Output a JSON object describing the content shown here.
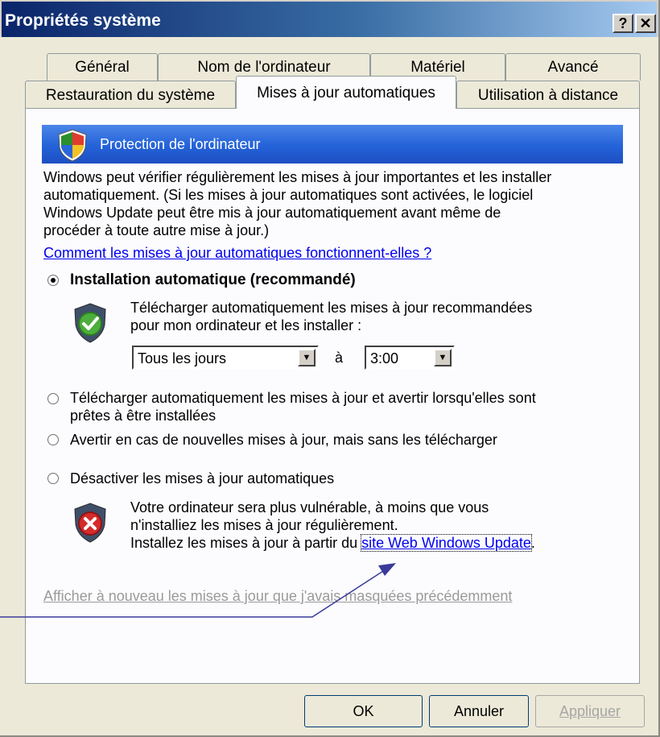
{
  "window": {
    "title": "Propriétés système",
    "help_label": "?",
    "close_label": "✕"
  },
  "tabs": {
    "row1": [
      "Général",
      "Nom de l'ordinateur",
      "Matériel",
      "Avancé"
    ],
    "row2": [
      "Restauration du système",
      "Mises à jour automatiques",
      "Utilisation à distance"
    ]
  },
  "banner": {
    "title": "Protection de l'ordinateur",
    "icon": "windows-security-shield-icon"
  },
  "intro": {
    "lines": [
      "Windows peut vérifier régulièrement les mises à jour importantes et les installer",
      "automatiquement. (Si les mises à jour automatiques sont activées, le logiciel",
      "Windows Update peut être mis à jour automatiquement avant même de",
      "procéder à toute autre mise à jour.)"
    ],
    "link": "Comment les mises à jour automatiques fonctionnent-elles ?"
  },
  "options": {
    "auto_install": {
      "label": "Installation automatique (recommandé)",
      "selected": true,
      "desc_line1": "Télécharger automatiquement les mises à jour recommandées",
      "desc_line2": "pour mon ordinateur et les installer :",
      "frequency": "Tous les jours",
      "at_label": "à",
      "time": "3:00",
      "icon": "green-check-shield-icon"
    },
    "download_notify": {
      "line1": "Télécharger automatiquement les mises à jour et avertir lorsqu'elles sont",
      "line2": "prêtes à être installées",
      "selected": false
    },
    "notify_only": {
      "label": "Avertir en cas de nouvelles mises à jour, mais sans les télécharger",
      "selected": false
    },
    "disable": {
      "label": "Désactiver les mises à jour automatiques",
      "selected": false,
      "warn_line1": "Votre ordinateur sera plus vulnérable, à moins que vous",
      "warn_line2": "n'installiez les mises à jour régulièrement.",
      "warn_line3_prefix": "Installez les mises à jour à partir du ",
      "warn_link": "site Web Windows Update",
      "warn_suffix": ".",
      "icon": "red-x-shield-icon"
    }
  },
  "hidden_updates_link": "Afficher à nouveau les mises à jour que j'avais masquées précédemment",
  "buttons": {
    "ok": "OK",
    "cancel": "Annuler",
    "apply": "Appliquer"
  },
  "colors": {
    "title_bar": "#0a246a",
    "banner": "#2462d8",
    "link": "#0000ee",
    "annotation_arrow": "#3a3a9a"
  }
}
